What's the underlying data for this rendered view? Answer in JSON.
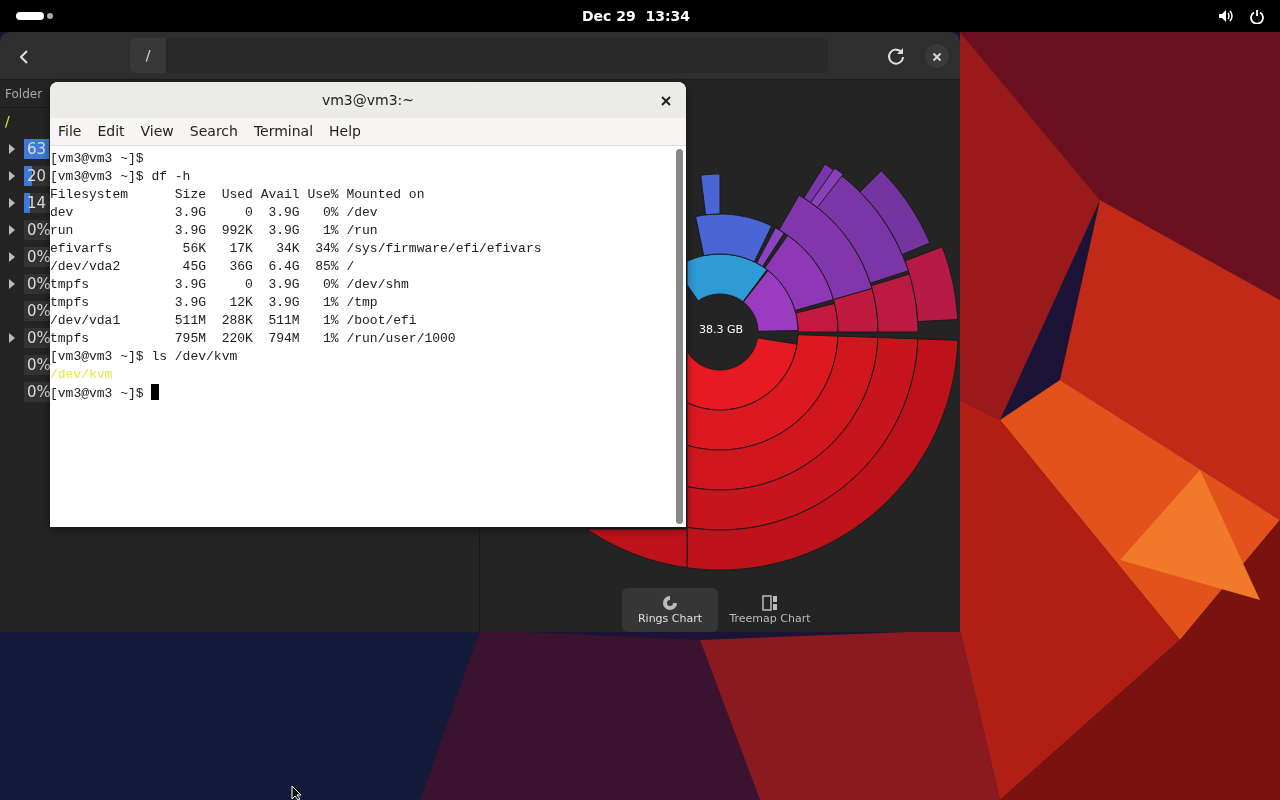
{
  "top_bar": {
    "clock": "Dec 29  13:34"
  },
  "analyzer": {
    "path": "/",
    "column": "Folder",
    "root": "/",
    "rows": [
      {
        "expandable": true,
        "usage": "63",
        "level": 0.63
      },
      {
        "expandable": true,
        "usage": "20",
        "level": 0.2
      },
      {
        "expandable": true,
        "usage": "14",
        "level": 0.14
      },
      {
        "expandable": true,
        "usage": "0%",
        "level": 0
      },
      {
        "expandable": true,
        "usage": "0%",
        "level": 0
      },
      {
        "expandable": true,
        "usage": "0%",
        "level": 0
      },
      {
        "expandable": false,
        "usage": "0%",
        "level": 0
      },
      {
        "expandable": true,
        "usage": "0%",
        "level": 0
      },
      {
        "expandable": false,
        "usage": "0%",
        "level": 0
      },
      {
        "expandable": false,
        "usage": "0%",
        "level": 0
      }
    ],
    "total": "38.3 GB",
    "views": [
      {
        "label": "Rings Chart",
        "kind": "rings",
        "selected": true
      },
      {
        "label": "Treemap Chart",
        "kind": "treemap",
        "selected": false
      }
    ]
  },
  "terminal": {
    "title": "vm3@vm3:~",
    "menu": [
      "File",
      "Edit",
      "View",
      "Search",
      "Terminal",
      "Help"
    ],
    "lines": [
      {
        "kind": "plain",
        "text": "[vm3@vm3 ~]$"
      },
      {
        "kind": "plain",
        "text": "[vm3@vm3 ~]$ df -h"
      },
      {
        "kind": "plain",
        "text": "Filesystem      Size  Used Avail Use% Mounted on"
      },
      {
        "kind": "plain",
        "text": "dev             3.9G     0  3.9G   0% /dev"
      },
      {
        "kind": "plain",
        "text": "run             3.9G  992K  3.9G   1% /run"
      },
      {
        "kind": "plain",
        "text": "efivarfs         56K   17K   34K  34% /sys/firmware/efi/efivars"
      },
      {
        "kind": "plain",
        "text": "/dev/vda2        45G   36G  6.4G  85% /"
      },
      {
        "kind": "plain",
        "text": "tmpfs           3.9G     0  3.9G   0% /dev/shm"
      },
      {
        "kind": "plain",
        "text": "tmpfs           3.9G   12K  3.9G   1% /tmp"
      },
      {
        "kind": "plain",
        "text": "/dev/vda1       511M  288K  511M   1% /boot/efi"
      },
      {
        "kind": "plain",
        "text": "tmpfs           795M  220K  794M   1% /run/user/1000"
      },
      {
        "kind": "plain",
        "text": "[vm3@vm3 ~]$ ls /dev/kvm"
      },
      {
        "kind": "device",
        "text": "/dev/kvm"
      },
      {
        "kind": "prompt",
        "text": "[vm3@vm3 ~]$ "
      }
    ]
  }
}
